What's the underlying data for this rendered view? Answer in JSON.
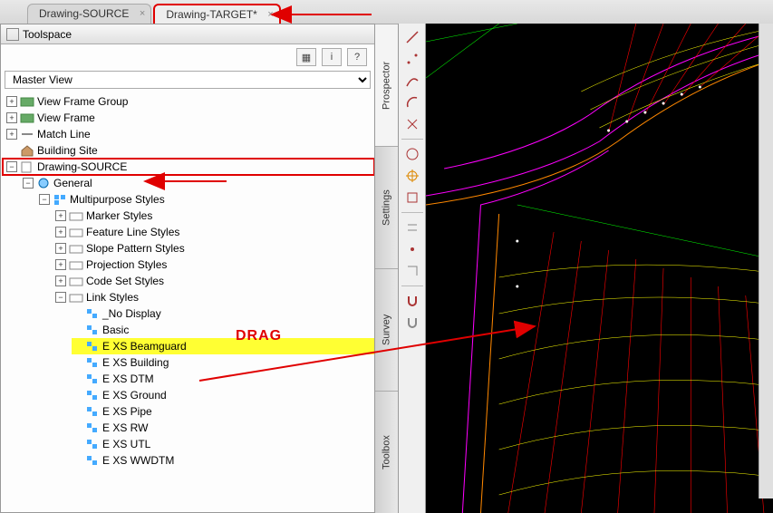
{
  "tabs": [
    {
      "label": "Drawing-SOURCE",
      "active": false
    },
    {
      "label": "Drawing-TARGET*",
      "active": true
    }
  ],
  "toolspace": {
    "title": "Toolspace",
    "view_selector": "Master View",
    "icon_buttons": [
      "layout-icon",
      "info-icon",
      "help-icon"
    ]
  },
  "tree": {
    "top": [
      {
        "label": "View Frame Group",
        "icon": "folder-green"
      },
      {
        "label": "View Frame",
        "icon": "folder-green"
      },
      {
        "label": "Match Line",
        "icon": "folder-green"
      },
      {
        "label": "Building Site",
        "icon": "house"
      }
    ],
    "source": {
      "label": "Drawing-SOURCE",
      "icon": "sheet"
    },
    "general": {
      "label": "General",
      "icon": "general"
    },
    "multipurpose": {
      "label": "Multipurpose Styles",
      "icon": "multi"
    },
    "style_groups": [
      {
        "label": "Marker Styles"
      },
      {
        "label": "Feature Line Styles"
      },
      {
        "label": "Slope Pattern Styles"
      },
      {
        "label": "Projection Styles"
      },
      {
        "label": "Code Set Styles"
      }
    ],
    "link_styles": {
      "label": "Link Styles",
      "items": [
        {
          "label": "_No Display"
        },
        {
          "label": "Basic"
        },
        {
          "label": "E XS Beamguard",
          "highlight": true
        },
        {
          "label": "E XS Building"
        },
        {
          "label": "E XS DTM"
        },
        {
          "label": "E XS Ground"
        },
        {
          "label": "E XS Pipe"
        },
        {
          "label": "E XS RW"
        },
        {
          "label": "E XS UTL"
        },
        {
          "label": "E XS WWDTM"
        }
      ]
    }
  },
  "side_tabs": [
    "Prospector",
    "Settings",
    "Survey",
    "Toolbox"
  ],
  "active_side_tab": 0,
  "annotations": {
    "drag_label": "DRAG",
    "highlight_tab": 1,
    "highlight_source": true
  },
  "colors": {
    "accent_red": "#e00000",
    "highlight": "#ffff33",
    "canvas_bg": "#000000"
  }
}
